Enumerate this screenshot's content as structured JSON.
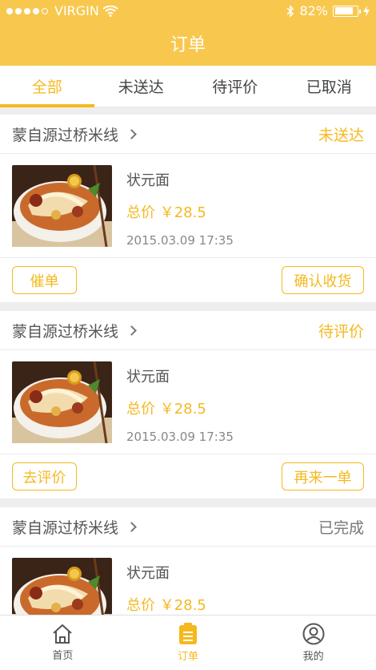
{
  "status_bar": {
    "carrier": "VIRGIN",
    "battery": "82%",
    "battery_level": 0.82
  },
  "header": {
    "title": "订单"
  },
  "tabs": [
    {
      "label": "全部",
      "active": true
    },
    {
      "label": "未送达",
      "active": false
    },
    {
      "label": "待评价",
      "active": false
    },
    {
      "label": "已取消",
      "active": false
    }
  ],
  "orders": [
    {
      "shop": "蒙自源过桥米线",
      "status": "未送达",
      "dish": "状元面",
      "price": "总价 ￥28.5",
      "date": "2015.03.09    17:35",
      "buttons": [
        "催单",
        "确认收货"
      ]
    },
    {
      "shop": "蒙自源过桥米线",
      "status": "待评价",
      "dish": "状元面",
      "price": "总价 ￥28.5",
      "date": "2015.03.09    17:35",
      "buttons": [
        "去评价",
        "再来一单"
      ]
    },
    {
      "shop": "蒙自源过桥米线",
      "status": "已完成",
      "dish": "状元面",
      "price": "总价 ￥28.5",
      "date": "",
      "buttons": []
    }
  ],
  "bottom_nav": [
    {
      "label": "首页",
      "icon": "home-icon"
    },
    {
      "label": "订单",
      "icon": "orders-icon"
    },
    {
      "label": "我的",
      "icon": "profile-icon"
    }
  ],
  "colors": {
    "brand": "#f8c84e",
    "accent": "#f5b91f"
  }
}
